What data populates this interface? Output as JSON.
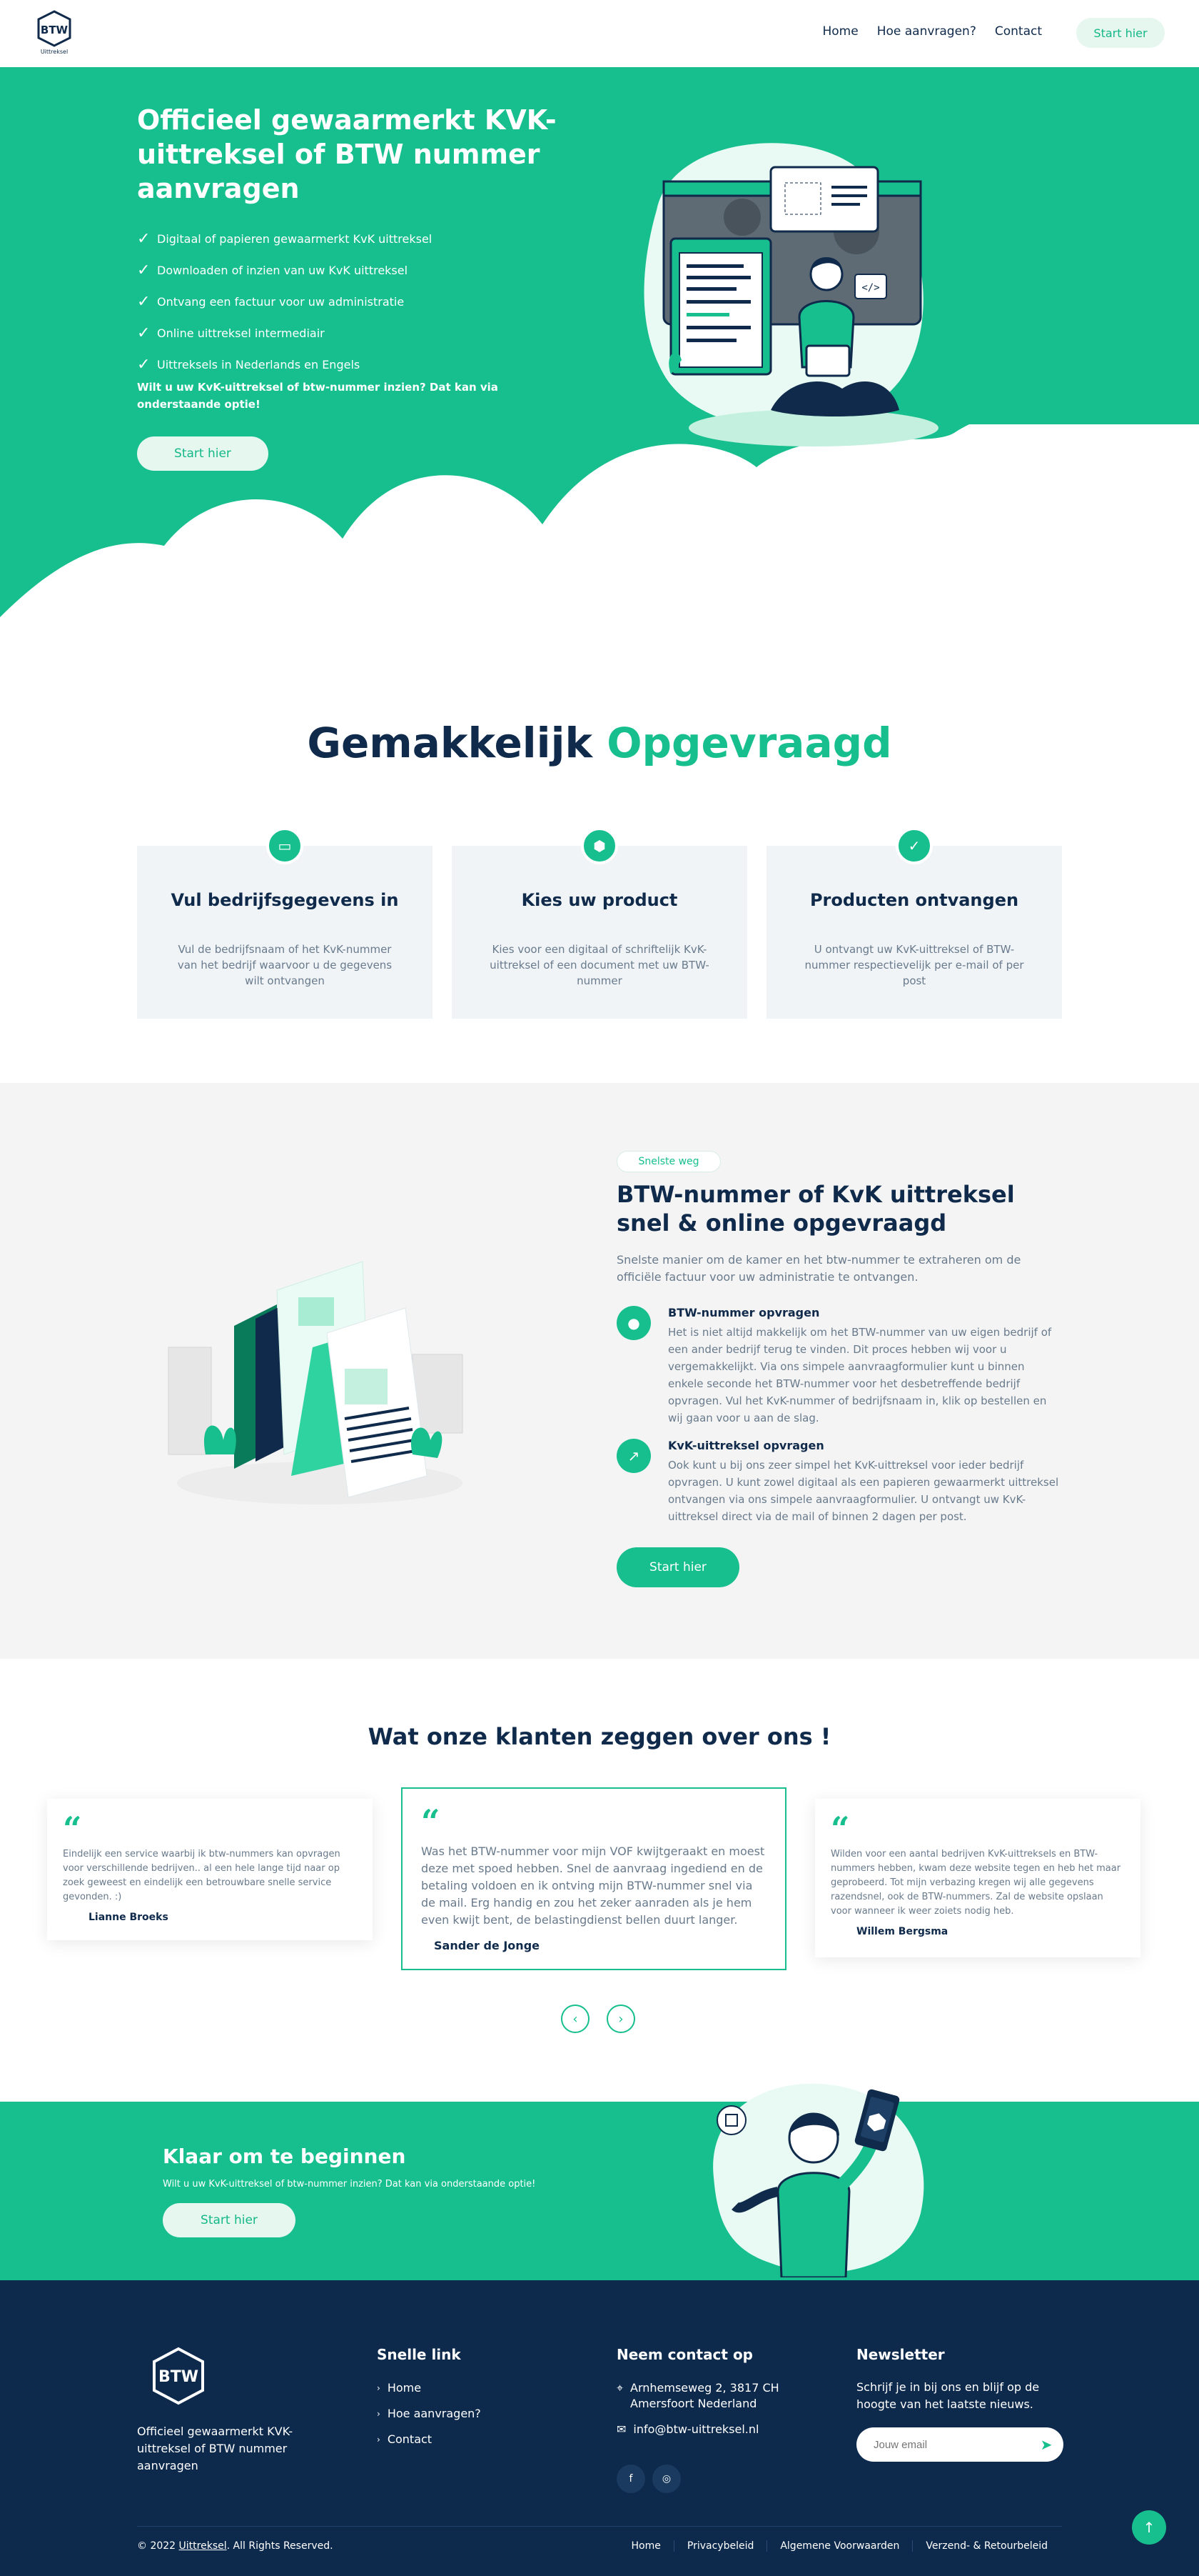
{
  "nav": {
    "logo_text": "BTW",
    "logo_sub": "Uittreksel",
    "links": [
      "Home",
      "Hoe aanvragen?",
      "Contact"
    ],
    "cta": "Start hier"
  },
  "hero": {
    "title": "Officieel gewaarmerkt KVK-uittreksel of BTW nummer aanvragen",
    "bullets": [
      "Digitaal of papieren gewaarmerkt KvK uittreksel",
      "Downloaden of inzien van uw KvK uittreksel",
      "Ontvang een factuur voor uw administratie",
      "Online uittreksel intermediair",
      "Uittreksels in Nederlands en Engels"
    ],
    "question": "Wilt u uw KvK-uittreksel of btw-nummer inzien? Dat kan via onderstaande optie!",
    "button": "Start hier"
  },
  "steps": {
    "heading_dark": "Gemakkelijk",
    "heading_accent": "Opgevraagd",
    "cards": [
      {
        "title": "Vul bedrijfsgegevens in",
        "text": "Vul de bedrijfsnaam of het KvK-nummer van het bedrijf waarvoor u de gegevens wilt ontvangen",
        "icon": "monitor-icon"
      },
      {
        "title": "Kies uw product",
        "text": "Kies voor een digitaal of schriftelijk KvK-uittreksel of een document met uw BTW-nummer",
        "icon": "box-icon"
      },
      {
        "title": "Producten ontvangen",
        "text": "U ontvangt uw KvK-uittreksel of BTW-nummer respectievelijk per e-mail of per post",
        "icon": "check-icon"
      }
    ]
  },
  "feature": {
    "badge": "Snelste weg",
    "title": "BTW-nummer of KvK uittreksel snel & online opgevraagd",
    "lead": "Snelste manier om de kamer en het btw-nummer te extraheren om de officiële factuur voor uw administratie te ontvangen.",
    "items": [
      {
        "title": "BTW-nummer opvragen",
        "text": "Het is niet altijd makkelijk om het BTW-nummer van uw eigen bedrijf of een ander bedrijf terug te vinden. Dit proces hebben wij voor u vergemakkelijkt. Via ons simpele aanvraagformulier kunt u binnen enkele seconde het BTW-nummer voor het desbetreffende bedrijf opvragen. Vul het KvK-nummer of bedrijfsnaam in, klik op bestellen en wij gaan voor u aan de slag."
      },
      {
        "title": "KvK-uittreksel opvragen",
        "text": "Ook kunt u bij ons zeer simpel het KvK-uittreksel voor ieder bedrijf opvragen. U kunt zowel digitaal als een papieren gewaarmerkt uittreksel ontvangen via ons simpele aanvraagformulier. U ontvangt uw KvK-uittreksel direct via de mail of binnen 2 dagen per post."
      }
    ],
    "button": "Start hier"
  },
  "testimonials": {
    "heading": "Wat onze klanten zeggen over ons !",
    "items": [
      {
        "text": "Eindelijk een service waarbij ik btw-nummers kan opvragen voor verschillende bedrijven.. al een hele lange tijd naar op zoek geweest en eindelijk een betrouwbare snelle service gevonden. :)",
        "name": "Lianne Broeks"
      },
      {
        "text": "Was het BTW-nummer voor mijn VOF kwijtgeraakt en moest deze met spoed hebben. Snel de aanvraag ingediend en de betaling voldoen en ik ontving mijn BTW-nummer snel via de mail. Erg handig en zou het zeker aanraden als je hem even kwijt bent, de belastingdienst bellen duurt langer.",
        "name": "Sander de Jonge"
      },
      {
        "text": "Wilden voor een aantal bedrijven KvK-uittreksels en BTW-nummers hebben, kwam deze website tegen en heb het maar geprobeerd. Tot mijn verbazing kregen wij alle gegevens razendsnel, ook de BTW-nummers. Zal de website opslaan voor wanneer ik weer zoiets nodig heb.",
        "name": "Willem Bergsma"
      }
    ],
    "prev": "‹",
    "next": "›"
  },
  "cta_band": {
    "title": "Klaar om te beginnen",
    "text": "Wilt u uw KvK-uittreksel of btw-nummer inzien? Dat kan via onderstaande optie!",
    "button": "Start hier"
  },
  "footer": {
    "tagline": "Officieel gewaarmerkt KVK-uittreksel of BTW nummer aanvragen",
    "quick_title": "Snelle link",
    "quick_links": [
      "Home",
      "Hoe aanvragen?",
      "Contact"
    ],
    "contact_title": "Neem contact op",
    "address": "Arnhemseweg 2, 3817 CH Amersfoort Nederland",
    "email": "info@btw-uittreksel.nl",
    "newsletter_title": "Newsletter",
    "newsletter_text": "Schrijf je in bij ons en blijf op de hoogte van het laatste nieuws.",
    "newsletter_placeholder": "Jouw email",
    "copyright_prefix": "© 2022",
    "copyright_brand": "Uittreksel",
    "copyright_suffix": ". All Rights Reserved.",
    "bottom_links": [
      "Home",
      "Privacybeleid",
      "Algemene Voorwaarden",
      "Verzend- & Retourbeleid"
    ]
  },
  "colors": {
    "brand": "#16bf8d",
    "navy": "#0d2a4d"
  }
}
